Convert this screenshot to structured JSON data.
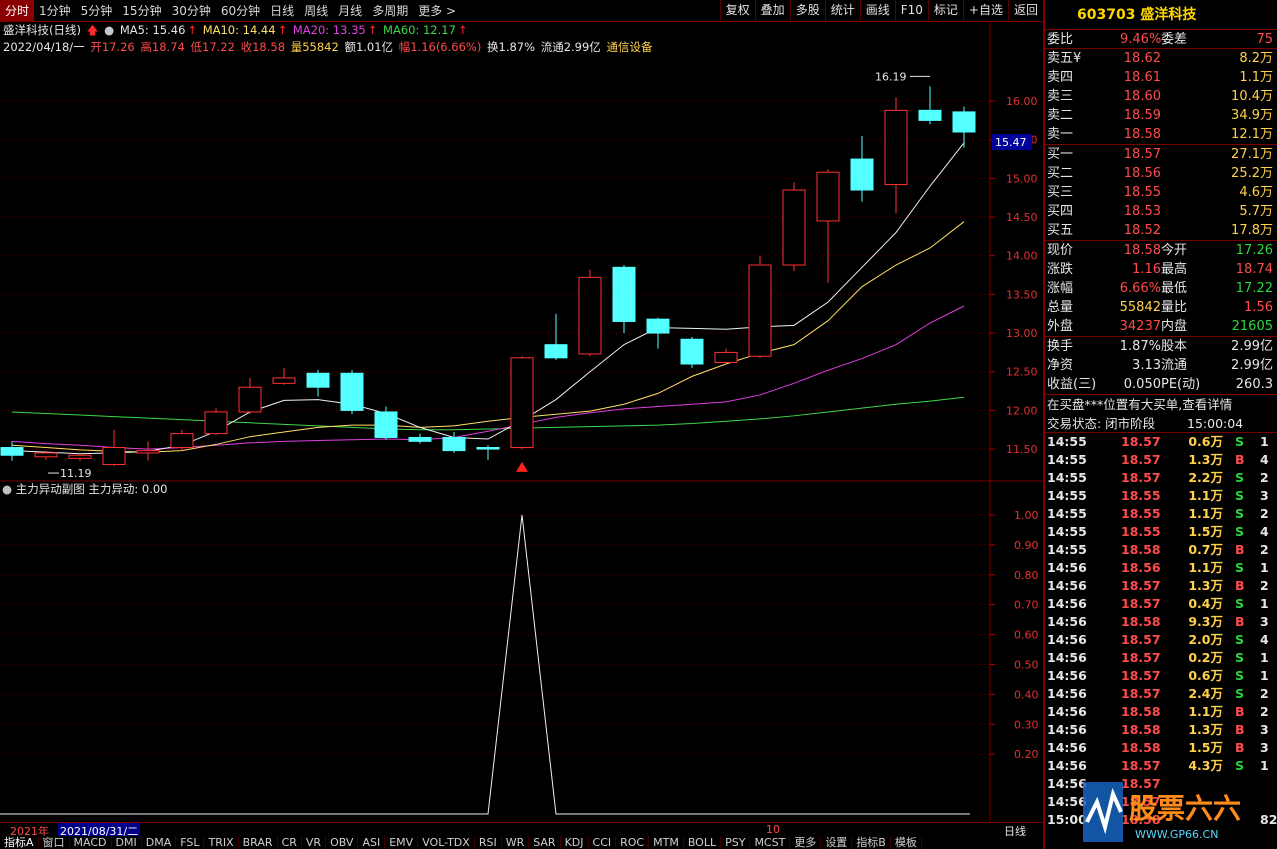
{
  "toolbar": {
    "tabs": [
      "分时",
      "1分钟",
      "5分钟",
      "15分钟",
      "30分钟",
      "60分钟",
      "日线",
      "周线",
      "月线",
      "多周期",
      "更多 >"
    ],
    "right": [
      "复权",
      "叠加",
      "多股",
      "统计",
      "画线",
      "F10",
      "标记",
      "+自选",
      "返回"
    ]
  },
  "header": {
    "stock_name": "盛洋科技(日线)",
    "ma5": "MA5: 15.46",
    "ma10": "MA10: 14.44",
    "ma20": "MA20: 13.35",
    "ma60": "MA60: 12.17",
    "date": "2022/04/18/一",
    "open": "开17.26",
    "high": "高18.74",
    "low": "低17.22",
    "close": "收18.58",
    "vol": "量55842",
    "amt": "额1.01亿",
    "chg": "幅1.16(6.66%)",
    "turn": "换1.87%",
    "float": "流通2.99亿",
    "sector": "通信设备"
  },
  "sub": {
    "title": "主力异动副图",
    "value": "主力异动: 0.00"
  },
  "price_labels": {
    "high": "16.19",
    "low": "11.19",
    "current": "15.47"
  },
  "chart_data": {
    "type": "candlestick",
    "ylim": [
      11.1,
      16.35
    ],
    "yticks": [
      "16.00",
      "15.50",
      "15.00",
      "14.50",
      "14.00",
      "13.50",
      "13.00",
      "12.50",
      "12.00",
      "11.50"
    ],
    "candles": [
      [
        11.52,
        11.42,
        11.6,
        11.35
      ],
      [
        11.4,
        11.45,
        11.48,
        11.36
      ],
      [
        11.38,
        11.42,
        11.44,
        11.35
      ],
      [
        11.3,
        11.52,
        11.75,
        11.28
      ],
      [
        11.45,
        11.48,
        11.6,
        11.35
      ],
      [
        11.52,
        11.7,
        11.75,
        11.48
      ],
      [
        11.7,
        11.98,
        12.03,
        11.68
      ],
      [
        11.98,
        12.3,
        12.42,
        11.95
      ],
      [
        12.35,
        12.42,
        12.55,
        12.33
      ],
      [
        12.48,
        12.3,
        12.52,
        12.18
      ],
      [
        12.48,
        12.0,
        12.52,
        11.95
      ],
      [
        11.98,
        11.65,
        12.05,
        11.62
      ],
      [
        11.65,
        11.6,
        11.7,
        11.57
      ],
      [
        11.65,
        11.48,
        11.72,
        11.45
      ],
      [
        11.52,
        11.5,
        11.55,
        11.36
      ],
      [
        11.52,
        12.68,
        12.7,
        11.5
      ],
      [
        12.85,
        12.68,
        13.25,
        12.65
      ],
      [
        12.73,
        13.72,
        13.82,
        12.7
      ],
      [
        13.85,
        13.15,
        13.88,
        13.0
      ],
      [
        13.18,
        13.0,
        13.2,
        12.8
      ],
      [
        12.92,
        12.6,
        12.95,
        12.55
      ],
      [
        12.62,
        12.75,
        12.8,
        12.6
      ],
      [
        12.7,
        13.88,
        14.0,
        12.68
      ],
      [
        13.88,
        14.85,
        14.95,
        13.8
      ],
      [
        14.45,
        15.08,
        15.12,
        13.65
      ],
      [
        15.25,
        14.85,
        15.55,
        14.7
      ],
      [
        14.92,
        15.88,
        16.05,
        14.55
      ],
      [
        15.88,
        15.75,
        16.19,
        15.7
      ],
      [
        15.86,
        15.6,
        15.93,
        15.4
      ]
    ],
    "ma5": [
      11.48,
      11.46,
      11.44,
      11.45,
      11.47,
      11.55,
      11.73,
      11.98,
      12.13,
      12.14,
      12.08,
      11.96,
      11.78,
      11.65,
      11.63,
      11.87,
      12.14,
      12.5,
      12.85,
      13.07,
      13.06,
      13.05,
      13.08,
      13.1,
      13.4,
      13.85,
      14.3,
      14.9,
      15.46
    ],
    "ma10": [
      11.55,
      11.52,
      11.49,
      11.47,
      11.46,
      11.48,
      11.56,
      11.66,
      11.72,
      11.78,
      11.81,
      11.81,
      11.78,
      11.8,
      11.86,
      11.91,
      11.95,
      11.99,
      12.08,
      12.22,
      12.44,
      12.6,
      12.74,
      12.85,
      13.16,
      13.6,
      13.88,
      14.1,
      14.44
    ],
    "ma20": [
      11.6,
      11.57,
      11.55,
      11.52,
      11.5,
      11.52,
      11.55,
      11.58,
      11.6,
      11.61,
      11.62,
      11.63,
      11.62,
      11.65,
      11.73,
      11.82,
      11.91,
      11.97,
      12.02,
      12.05,
      12.08,
      12.11,
      12.2,
      12.35,
      12.52,
      12.67,
      12.85,
      13.13,
      13.35
    ],
    "ma60": [
      11.98,
      11.96,
      11.94,
      11.92,
      11.9,
      11.88,
      11.86,
      11.84,
      11.82,
      11.8,
      11.78,
      11.76,
      11.75,
      11.75,
      11.76,
      11.77,
      11.78,
      11.79,
      11.8,
      11.81,
      11.83,
      11.86,
      11.89,
      11.93,
      11.98,
      12.03,
      12.08,
      12.12,
      12.17
    ],
    "sub_ylim": [
      0,
      1.05
    ],
    "sub_yticks": [
      "1.00",
      "0.90",
      "0.80",
      "0.70",
      "0.60",
      "0.50",
      "0.40",
      "0.30",
      "0.20"
    ],
    "sub_values": [
      0,
      0,
      0,
      0,
      0,
      0,
      0,
      0,
      0,
      0,
      0,
      0,
      0,
      0,
      0,
      1,
      0,
      0,
      0,
      0,
      0,
      0,
      0,
      0,
      0,
      0,
      0,
      0,
      0
    ]
  },
  "bottom": {
    "year": "2021年",
    "date": "2021/08/31/二",
    "month": "10",
    "period": "日线"
  },
  "indicators": [
    "指标A",
    "窗口",
    "MACD",
    "DMI",
    "DMA",
    "FSL",
    "TRIX",
    "BRAR",
    "CR",
    "VR",
    "OBV",
    "ASI",
    "EMV",
    "VOL-TDX",
    "RSI",
    "WR",
    "SAR",
    "KDJ",
    "CCI",
    "ROC",
    "MTM",
    "BOLL",
    "PSY",
    "MCST",
    "更多",
    "设置",
    "指标B",
    "模板"
  ],
  "side": {
    "code": "603703",
    "name": "盛洋科技",
    "wb": {
      "label": "委比",
      "pct": "9.46%",
      "diff_label": "委差",
      "diff": "75"
    },
    "sells": [
      [
        "卖五¥",
        "18.62",
        "8.2万"
      ],
      [
        "卖四",
        "18.61",
        "1.1万"
      ],
      [
        "卖三",
        "18.60",
        "10.4万"
      ],
      [
        "卖二",
        "18.59",
        "34.9万"
      ],
      [
        "卖一",
        "18.58",
        "12.1万"
      ]
    ],
    "buys": [
      [
        "买一",
        "18.57",
        "27.1万"
      ],
      [
        "买二",
        "18.56",
        "25.2万"
      ],
      [
        "买三",
        "18.55",
        "4.6万"
      ],
      [
        "买四",
        "18.53",
        "5.7万"
      ],
      [
        "买五",
        "18.52",
        "17.8万"
      ]
    ],
    "stats": [
      [
        "现价",
        "18.58",
        "今开",
        "17.26"
      ],
      [
        "涨跌",
        "1.16",
        "最高",
        "18.74"
      ],
      [
        "涨幅",
        "6.66%",
        "最低",
        "17.22"
      ],
      [
        "总量",
        "55842",
        "量比",
        "1.56"
      ],
      [
        "外盘",
        "34237",
        "内盘",
        "21605"
      ]
    ],
    "finance": [
      [
        "换手",
        "1.87%",
        "股本",
        "2.99亿"
      ],
      [
        "净资",
        "3.13",
        "流通",
        "2.99亿"
      ],
      [
        "收益(三)",
        "0.050",
        "PE(动)",
        "260.3"
      ]
    ],
    "notice": "在买盘***位置有大买单,查看详情",
    "trade_status": "交易状态: 闭市阶段",
    "trade_time": "15:00:04",
    "ticks": [
      [
        "14:55",
        "18.57",
        "0.6万",
        "S",
        "1"
      ],
      [
        "14:55",
        "18.57",
        "1.3万",
        "B",
        "4"
      ],
      [
        "14:55",
        "18.57",
        "2.2万",
        "S",
        "2"
      ],
      [
        "14:55",
        "18.55",
        "1.1万",
        "S",
        "3"
      ],
      [
        "14:55",
        "18.55",
        "1.1万",
        "S",
        "2"
      ],
      [
        "14:55",
        "18.55",
        "1.5万",
        "S",
        "4"
      ],
      [
        "14:55",
        "18.58",
        "0.7万",
        "B",
        "2"
      ],
      [
        "14:56",
        "18.56",
        "1.1万",
        "S",
        "1"
      ],
      [
        "14:56",
        "18.57",
        "1.3万",
        "B",
        "2"
      ],
      [
        "14:56",
        "18.57",
        "0.4万",
        "S",
        "1"
      ],
      [
        "14:56",
        "18.58",
        "9.3万",
        "B",
        "3"
      ],
      [
        "14:56",
        "18.57",
        "2.0万",
        "S",
        "4"
      ],
      [
        "14:56",
        "18.57",
        "0.2万",
        "S",
        "1"
      ],
      [
        "14:56",
        "18.57",
        "0.6万",
        "S",
        "1"
      ],
      [
        "14:56",
        "18.57",
        "2.4万",
        "S",
        "2"
      ],
      [
        "14:56",
        "18.58",
        "1.1万",
        "B",
        "2"
      ],
      [
        "14:56",
        "18.58",
        "1.3万",
        "B",
        "3"
      ],
      [
        "14:56",
        "18.58",
        "1.5万",
        "B",
        "3"
      ],
      [
        "14:56",
        "18.57",
        "4.3万",
        "S",
        "1"
      ],
      [
        "14:56",
        "18.57",
        "",
        "",
        ""
      ],
      [
        "14:56",
        "18.57",
        "",
        "",
        ""
      ],
      [
        "15:00",
        "18.58",
        "",
        "",
        "82"
      ]
    ],
    "colors": {
      "up": "#ff4b4b",
      "down": "#2bd640",
      "vol": "#ffd24a"
    }
  },
  "watermark": {
    "logo": "股票六六",
    "site": "WWW.GP66.CN"
  }
}
